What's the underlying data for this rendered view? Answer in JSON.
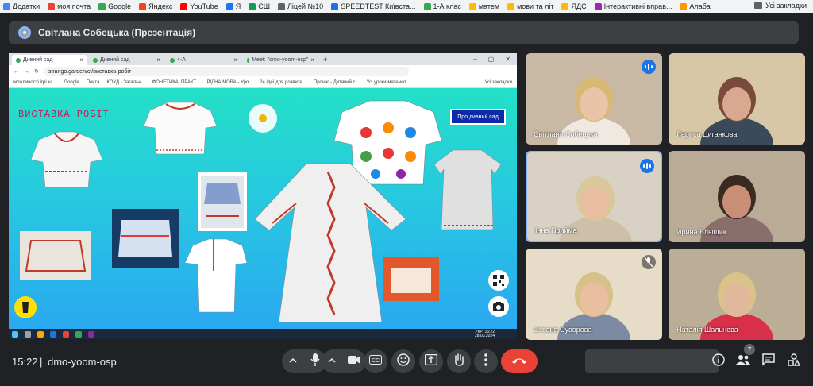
{
  "bookmarks": [
    {
      "label": "Додатки",
      "color": "#4285f4"
    },
    {
      "label": "моя почта",
      "color": "#ea4335"
    },
    {
      "label": "Google",
      "color": "#34a853"
    },
    {
      "label": "Яндекс",
      "color": "#fc3f1d"
    },
    {
      "label": "YouTube",
      "color": "#ff0000"
    },
    {
      "label": "Я",
      "color": "#1877f2"
    },
    {
      "label": "ЄШ",
      "color": "#0f9d58"
    },
    {
      "label": "Ліцей №10",
      "color": "#5f6368"
    },
    {
      "label": "SPEEDTEST Київста...",
      "color": "#1a73e8"
    },
    {
      "label": "1-А клас",
      "color": "#34a853"
    },
    {
      "label": "матем",
      "color": "#fbbc04"
    },
    {
      "label": "мови та літ",
      "color": "#fbbc04"
    },
    {
      "label": "ЯДС",
      "color": "#fbbc04"
    },
    {
      "label": "Інтерактивні вправ...",
      "color": "#9c27b0"
    },
    {
      "label": "Алаба",
      "color": "#ff9800"
    }
  ],
  "bookmarks_right": "Усі закладки",
  "presenter": {
    "label": "Світлана Собецька (Презентація)"
  },
  "shared_screen": {
    "tabs": [
      {
        "label": "Дивний сад",
        "active": true
      },
      {
        "label": "Дивний сад",
        "active": false
      },
      {
        "label": "4-А",
        "active": false
      },
      {
        "label": "Meet: \"dmo-yoom-osp\"",
        "active": false
      }
    ],
    "url": "strango.garden/ct/виставка-робіт",
    "mini_bookmarks": [
      "можливості ігрі ка...",
      "Google",
      "Почта",
      "КОУД - Загальн...",
      "ФОНЕТИКА: ПРАКТ...",
      "РІДНА МОВА - Уро...",
      "24 ідеї для розвите...",
      "Прочаг - Дитячий с...",
      "Усі уроки математ..."
    ],
    "mini_bookmarks_right": "Усі закладки",
    "page_title": "ВИСТАВКА РОБІТ",
    "about_button": "Про дивний сад",
    "taskbar_time": "15:22",
    "taskbar_date": "28.03.2024",
    "taskbar_lang": "УКР"
  },
  "participants": [
    {
      "name": "Світлана Собецька",
      "speaking": false,
      "badge": "audio",
      "bg": "#c9b8a3",
      "skin": "#e8c4a8",
      "hair": "#d9b873",
      "shirt": "#efe9e2"
    },
    {
      "name": "Лариса Циганкова",
      "speaking": false,
      "badge": "none",
      "bg": "#d8c7a6",
      "skin": "#d9a890",
      "hair": "#7a4b3a",
      "shirt": "#3b4a5a"
    },
    {
      "name": "Інна Прийма",
      "speaking": true,
      "badge": "audio",
      "bg": "#d9d1c3",
      "skin": "#e8bda0",
      "hair": "#d8c89a",
      "shirt": "#cdbfa8"
    },
    {
      "name": "Ирина Блыщик",
      "speaking": false,
      "badge": "none",
      "bg": "#b9ab96",
      "skin": "#c98e76",
      "hair": "#3a2a22",
      "shirt": "#8a6d6d"
    },
    {
      "name": "Оксана Суворова",
      "speaking": false,
      "badge": "muted",
      "bg": "#e6dcc8",
      "skin": "#e9bfa0",
      "hair": "#d7c08a",
      "shirt": "#7c8aa3"
    },
    {
      "name": "Наталія Шальнова",
      "speaking": false,
      "badge": "none",
      "bg": "#bcae96",
      "skin": "#e2b89c",
      "hair": "#d9c388",
      "shirt": "#d8304a"
    }
  ],
  "bottom": {
    "time": "15:22",
    "separator": "|",
    "meeting_code": "dmo-yoom-osp",
    "people_count": "7",
    "icons": [
      "chevron-up",
      "mic",
      "chevron-up",
      "camera",
      "captions",
      "emoji",
      "present",
      "raise-hand",
      "more",
      "end-call",
      "info",
      "people",
      "chat",
      "activities"
    ],
    "end_call_color": "#ea4335"
  },
  "colors": {
    "accent": "#8ab4f8",
    "panel": "#3c4043",
    "background": "#202124"
  }
}
